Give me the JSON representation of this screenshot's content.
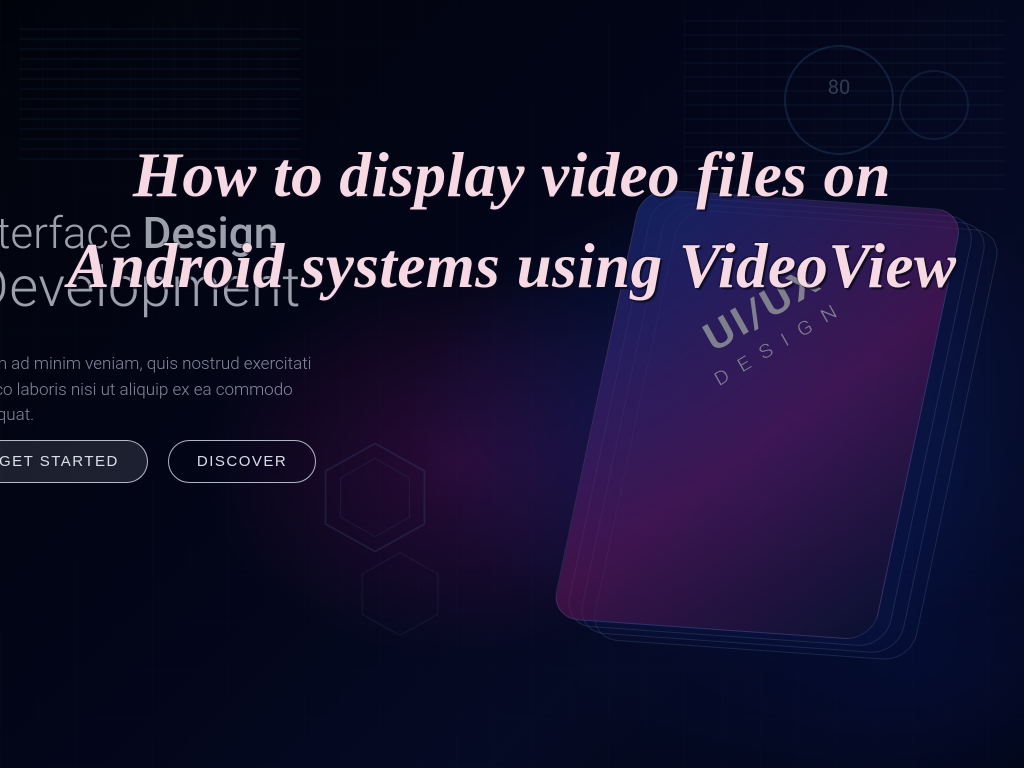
{
  "overlay": {
    "title": "How to display video files on Android systems using VideoView"
  },
  "hero": {
    "heading_line1_light": "nterface ",
    "heading_line1_strong": "Design",
    "heading_line2": "Development",
    "body": "enim ad minim veniam, quis nostrud exercitati\namco laboris nisi ut aliquip ex ea commodo\nnsequat.",
    "btn_primary": "GET STARTED",
    "btn_secondary": "DISCOVER"
  },
  "device": {
    "label_main": "UI/UX",
    "label_sub": "DESIGN"
  },
  "gauge": {
    "value": "80"
  }
}
